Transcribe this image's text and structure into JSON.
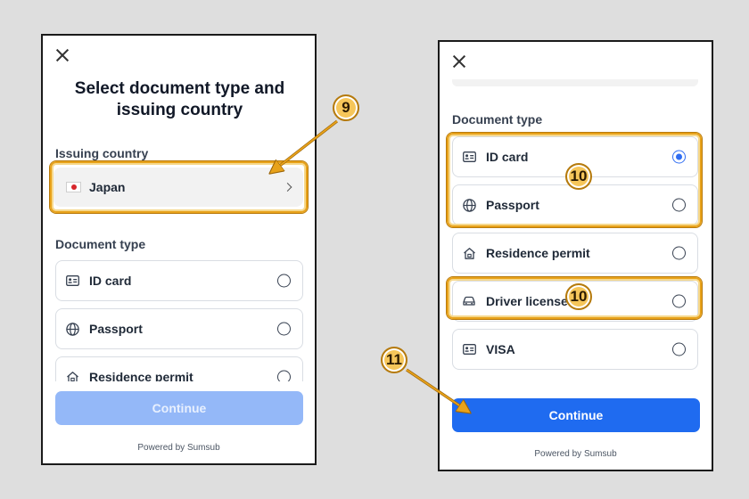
{
  "left_panel": {
    "title_line1": "Select document type and",
    "title_line2": "issuing country",
    "issuing_country_label": "Issuing country",
    "country": {
      "name": "Japan",
      "flag_icon": "japan-flag-icon"
    },
    "document_type_label": "Document type",
    "options": [
      {
        "label": "ID card",
        "icon": "id-card-icon",
        "selected": false
      },
      {
        "label": "Passport",
        "icon": "globe-icon",
        "selected": false
      },
      {
        "label": "Residence permit",
        "icon": "house-icon",
        "selected": false
      }
    ],
    "continue_label": "Continue",
    "continue_enabled": false,
    "powered_by": "Powered by Sumsub"
  },
  "right_panel": {
    "document_type_label": "Document type",
    "options": [
      {
        "label": "ID card",
        "icon": "id-card-icon",
        "selected": true
      },
      {
        "label": "Passport",
        "icon": "globe-icon",
        "selected": false
      },
      {
        "label": "Residence permit",
        "icon": "house-icon",
        "selected": false
      },
      {
        "label": "Driver license",
        "icon": "car-icon",
        "selected": false
      },
      {
        "label": "VISA",
        "icon": "id-card-icon",
        "selected": false
      }
    ],
    "continue_label": "Continue",
    "continue_enabled": true,
    "powered_by": "Powered by Sumsub"
  },
  "annotations": [
    {
      "number": "9",
      "target": "issuing country selector"
    },
    {
      "number": "10",
      "target": "ID card / Passport options"
    },
    {
      "number": "10",
      "target": "Driver license option"
    },
    {
      "number": "11",
      "target": "Continue button"
    }
  ],
  "colors": {
    "primary": "#1f6bf0",
    "primary_disabled": "#94b8f8",
    "highlight": "#e8a21a",
    "radio_selected": "#2f6df2",
    "background": "#dedede"
  }
}
